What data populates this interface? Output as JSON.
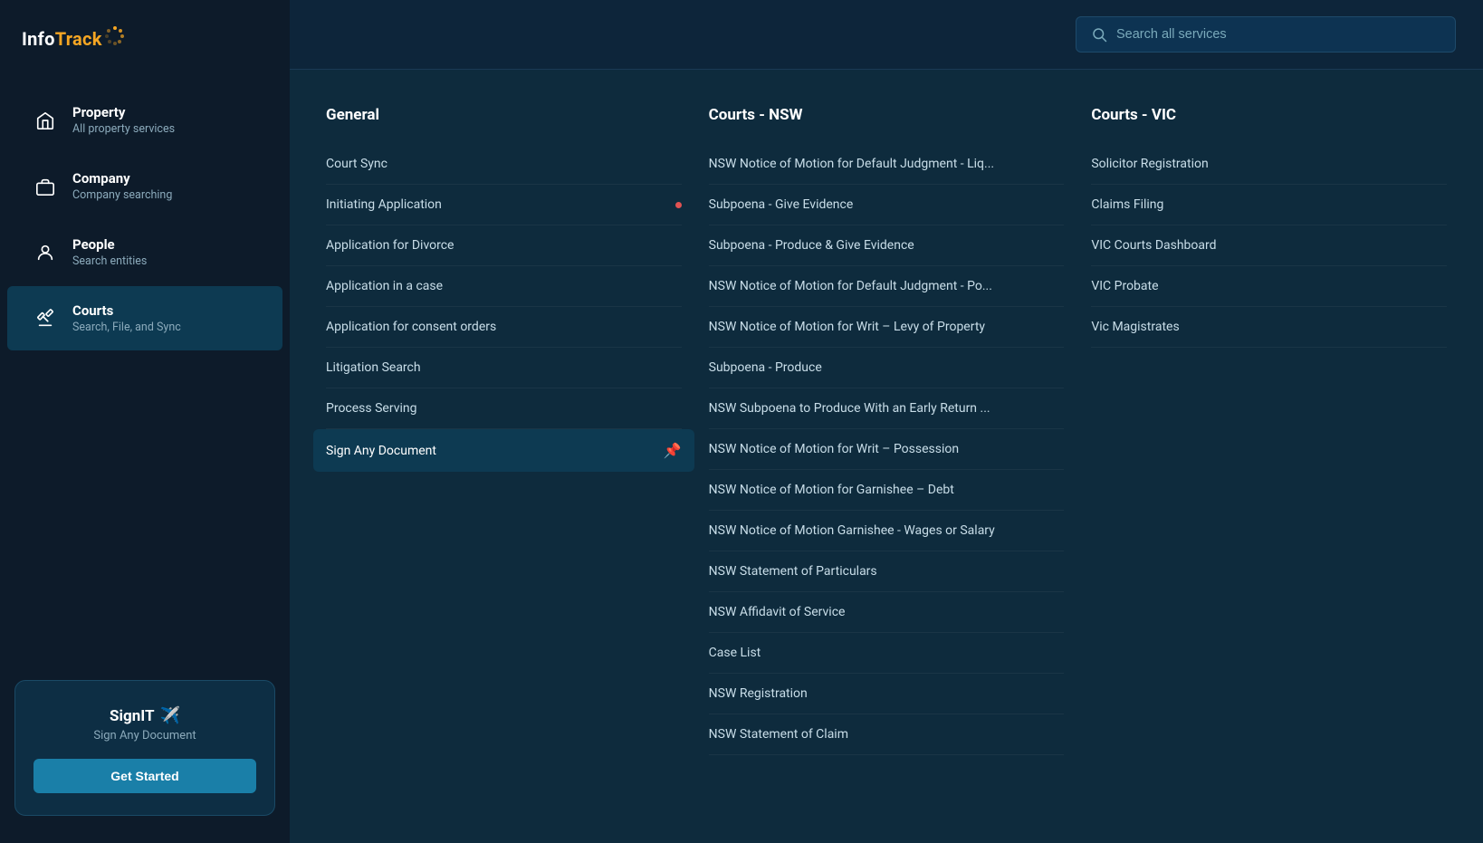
{
  "logo": {
    "text": "InfoTrack",
    "dots_symbol": "✦"
  },
  "sidebar": {
    "nav_items": [
      {
        "id": "property",
        "title": "Property",
        "subtitle": "All property services",
        "icon": "home",
        "active": false
      },
      {
        "id": "company",
        "title": "Company",
        "subtitle": "Company searching",
        "icon": "briefcase",
        "active": false
      },
      {
        "id": "people",
        "title": "People",
        "subtitle": "Search entities",
        "icon": "person",
        "active": false
      },
      {
        "id": "courts",
        "title": "Courts",
        "subtitle": "Search, File, and Sync",
        "icon": "gavel",
        "active": true
      }
    ],
    "signit": {
      "title": "SignIT",
      "icon": "✈",
      "subtitle": "Sign Any Document",
      "button_label": "Get Started"
    }
  },
  "topbar": {
    "search_placeholder": "Search all services"
  },
  "columns": [
    {
      "id": "general",
      "header": "General",
      "items": [
        {
          "label": "Court Sync",
          "highlighted": false,
          "red_dot": false,
          "pinned": false
        },
        {
          "label": "Initiating Application",
          "highlighted": false,
          "red_dot": true,
          "pinned": false
        },
        {
          "label": "Application for Divorce",
          "highlighted": false,
          "red_dot": false,
          "pinned": false
        },
        {
          "label": "Application in a case",
          "highlighted": false,
          "red_dot": false,
          "pinned": false
        },
        {
          "label": "Application for consent orders",
          "highlighted": false,
          "red_dot": false,
          "pinned": false
        },
        {
          "label": "Litigation Search",
          "highlighted": false,
          "red_dot": false,
          "pinned": false
        },
        {
          "label": "Process Serving",
          "highlighted": false,
          "red_dot": false,
          "pinned": false
        },
        {
          "label": "Sign Any Document",
          "highlighted": true,
          "red_dot": false,
          "pinned": true
        }
      ]
    },
    {
      "id": "courts-nsw",
      "header": "Courts - NSW",
      "items": [
        {
          "label": "NSW Notice of Motion for Default Judgment - Liq...",
          "highlighted": false,
          "red_dot": false,
          "pinned": false
        },
        {
          "label": "Subpoena - Give Evidence",
          "highlighted": false,
          "red_dot": false,
          "pinned": false
        },
        {
          "label": "Subpoena - Produce & Give Evidence",
          "highlighted": false,
          "red_dot": false,
          "pinned": false
        },
        {
          "label": "NSW Notice of Motion for Default Judgment - Po...",
          "highlighted": false,
          "red_dot": false,
          "pinned": false
        },
        {
          "label": "NSW Notice of Motion for Writ – Levy of Property",
          "highlighted": false,
          "red_dot": false,
          "pinned": false
        },
        {
          "label": "Subpoena - Produce",
          "highlighted": false,
          "red_dot": false,
          "pinned": false
        },
        {
          "label": "NSW Subpoena to Produce With an Early Return ...",
          "highlighted": false,
          "red_dot": false,
          "pinned": false
        },
        {
          "label": "NSW Notice of Motion for Writ – Possession",
          "highlighted": false,
          "red_dot": false,
          "pinned": false
        },
        {
          "label": "NSW Notice of Motion for Garnishee – Debt",
          "highlighted": false,
          "red_dot": false,
          "pinned": false
        },
        {
          "label": "NSW Notice of Motion Garnishee - Wages or Salary",
          "highlighted": false,
          "red_dot": false,
          "pinned": false
        },
        {
          "label": "NSW Statement of Particulars",
          "highlighted": false,
          "red_dot": false,
          "pinned": false
        },
        {
          "label": "NSW Affidavit of Service",
          "highlighted": false,
          "red_dot": false,
          "pinned": false
        },
        {
          "label": "Case List",
          "highlighted": false,
          "red_dot": false,
          "pinned": false
        },
        {
          "label": "NSW Registration",
          "highlighted": false,
          "red_dot": false,
          "pinned": false
        },
        {
          "label": "NSW Statement of Claim",
          "highlighted": false,
          "red_dot": false,
          "pinned": false
        }
      ]
    },
    {
      "id": "courts-vic",
      "header": "Courts - VIC",
      "items": [
        {
          "label": "Solicitor Registration",
          "highlighted": false,
          "red_dot": false,
          "pinned": false
        },
        {
          "label": "Claims Filing",
          "highlighted": false,
          "red_dot": false,
          "pinned": false
        },
        {
          "label": "VIC Courts Dashboard",
          "highlighted": false,
          "red_dot": false,
          "pinned": false
        },
        {
          "label": "VIC Probate",
          "highlighted": false,
          "red_dot": false,
          "pinned": false
        },
        {
          "label": "Vic Magistrates",
          "highlighted": false,
          "red_dot": false,
          "pinned": false
        }
      ]
    }
  ]
}
